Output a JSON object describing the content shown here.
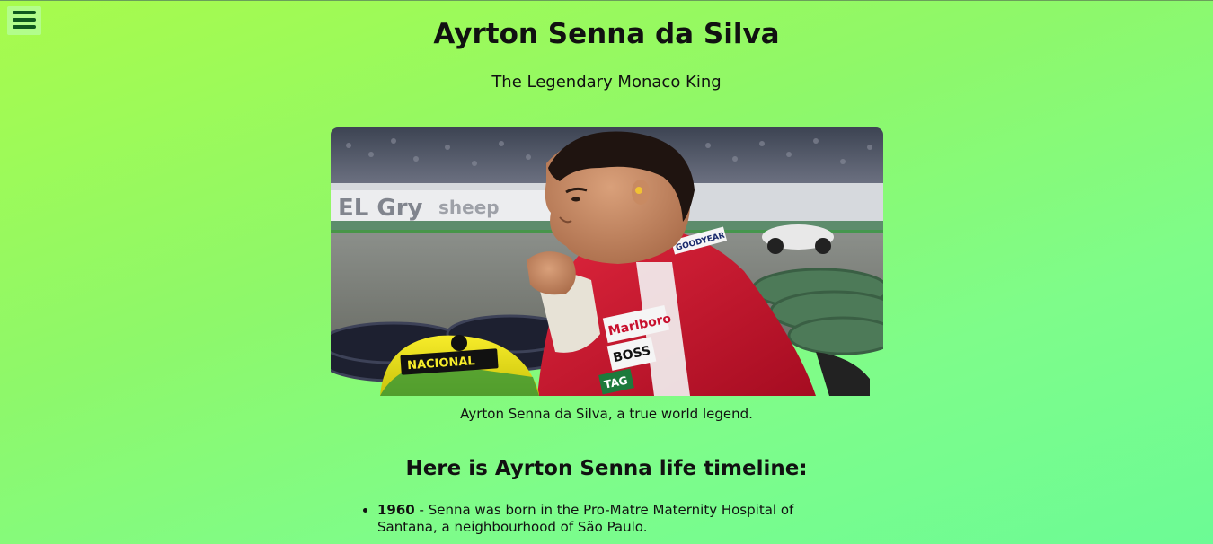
{
  "menu": {
    "icon": "hamburger-menu-icon"
  },
  "header": {
    "title": "Ayrton Senna da Silva",
    "subtitle": "The Legendary Monaco King"
  },
  "figure": {
    "caption": "Ayrton Senna da Silva, a true world legend.",
    "helmet_text": "NACIONAL",
    "suit_text": [
      "Marlboro",
      "BOSS",
      "GOODYEAR",
      "TAG"
    ]
  },
  "timeline": {
    "heading": "Here is Ayrton Senna life timeline:",
    "items": [
      {
        "year": "1960",
        "text": " - Senna was born in the Pro-Matre Maternity Hospital of Santana, a neighbourhood of São Paulo."
      }
    ]
  },
  "colors": {
    "background_start": "#a8fb4c",
    "background_end": "#6cfb95",
    "menu_icon": "#0f5a1e",
    "suit_red": "#c8102e",
    "helmet_yellow": "#f2e20a"
  }
}
